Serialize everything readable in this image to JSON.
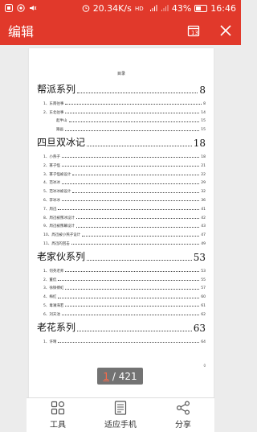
{
  "status": {
    "speed": "20.34K/s",
    "network": "HD 4G",
    "battery": "43%",
    "time": "16:46"
  },
  "appbar": {
    "title": "编辑"
  },
  "document": {
    "heading": "目录",
    "page_footer": "0",
    "sections": [
      {
        "title": "帮派系列",
        "page": "8",
        "items": [
          {
            "label": "1、东南往事",
            "page": "8",
            "sub": false
          },
          {
            "label": "2、东北往事",
            "page": "14",
            "sub": false
          },
          {
            "label": "起半山",
            "page": "15",
            "sub": true
          },
          {
            "label": "跟画",
            "page": "15",
            "sub": true
          }
        ]
      },
      {
        "title": "四旦双冰记",
        "page": "18",
        "items": [
          {
            "label": "1、小燕子",
            "page": "18",
            "sub": false
          },
          {
            "label": "2、寡子怪",
            "page": "21",
            "sub": false
          },
          {
            "label": "3、寡子怪被设计",
            "page": "22",
            "sub": false
          },
          {
            "label": "4、范冰冰",
            "page": "29",
            "sub": false
          },
          {
            "label": "5、范冰冰被设计",
            "page": "32",
            "sub": false
          },
          {
            "label": "6、李冰冰",
            "page": "36",
            "sub": false
          },
          {
            "label": "7、周迅",
            "page": "41",
            "sub": false
          },
          {
            "label": "8、周迅被叛冰设计",
            "page": "42",
            "sub": false
          },
          {
            "label": "9、周迅被叛幕设计",
            "page": "43",
            "sub": false
          },
          {
            "label": "10、周迅被小燕子设计",
            "page": "47",
            "sub": false
          },
          {
            "label": "11、周迅的回击",
            "page": "49",
            "sub": false
          }
        ]
      },
      {
        "title": "老家伙系列",
        "page": "53",
        "items": [
          {
            "label": "1、何英老师",
            "page": "53",
            "sub": false
          },
          {
            "label": "2、董侃",
            "page": "55",
            "sub": false
          },
          {
            "label": "3、徐铮搏虹",
            "page": "57",
            "sub": false
          },
          {
            "label": "4、梅红",
            "page": "60",
            "sub": false
          },
          {
            "label": "5、毒澜海若",
            "page": "61",
            "sub": false
          },
          {
            "label": "6、刘天池",
            "page": "62",
            "sub": false
          }
        ]
      },
      {
        "title": "老花系列",
        "page": "63",
        "items": [
          {
            "label": "1、许晴",
            "page": "64",
            "sub": false
          }
        ]
      }
    ]
  },
  "pager": {
    "current": "1",
    "separator": " / ",
    "total": "421"
  },
  "toolbar": {
    "tools_label": "工具",
    "fit_label": "适应手机",
    "share_label": "分享"
  },
  "colors": {
    "brand": "#e1392b",
    "pager_current": "#ff6b4a"
  },
  "icons": {
    "appbar_right": [
      "fit-page-icon",
      "close-icon"
    ],
    "toolbar": [
      "grid-tools-icon",
      "document-fit-icon",
      "share-icon"
    ]
  }
}
